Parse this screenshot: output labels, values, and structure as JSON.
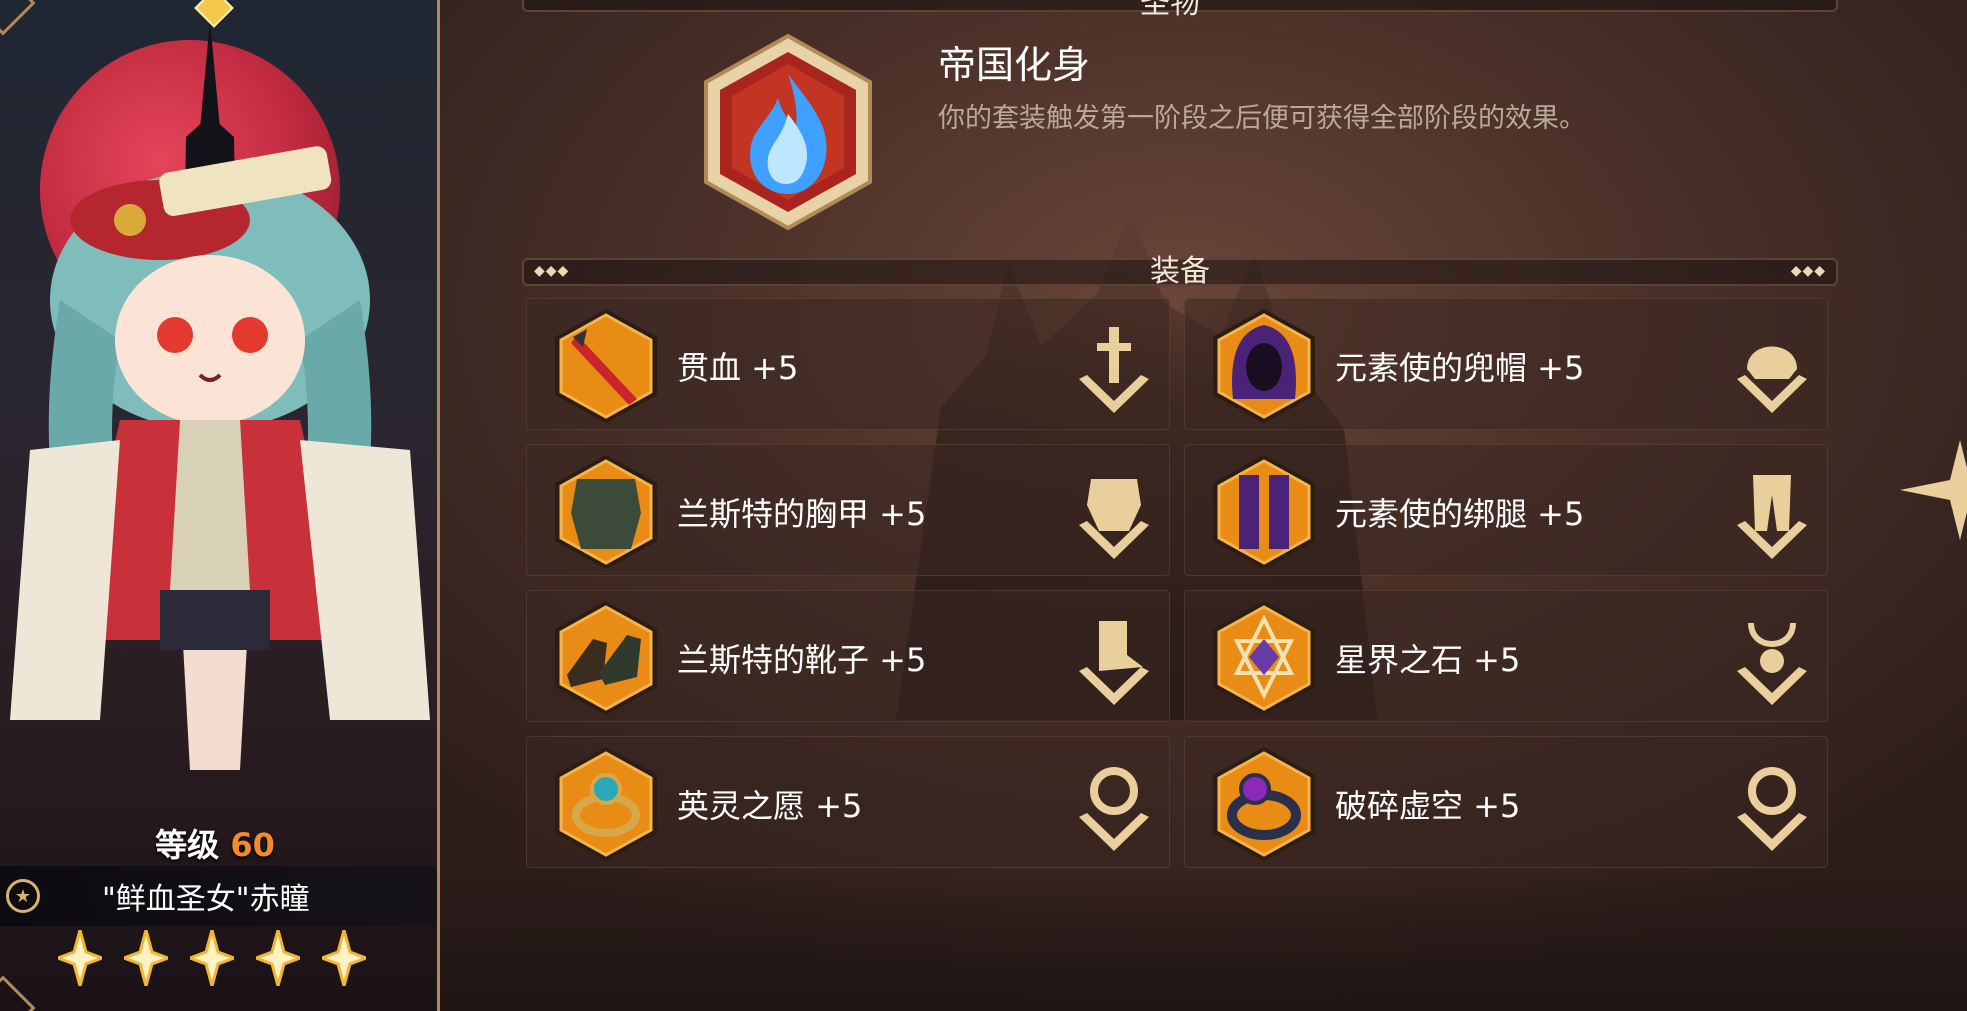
{
  "header": {
    "title": "圣物"
  },
  "artifact": {
    "name": "帝国化身",
    "description": "你的套装触发第一阶段之后便可获得全部阶段的效果。",
    "icon": "blue-flame-icon"
  },
  "section": {
    "title": "装备",
    "dots": "◆◆◆"
  },
  "equipment": [
    {
      "label": "贯血 +5",
      "icon": "sword-icon",
      "type_icon": "weapon-type-icon"
    },
    {
      "label": "元素使的兜帽 +5",
      "icon": "hood-icon",
      "type_icon": "helmet-type-icon"
    },
    {
      "label": "兰斯特的胸甲 +5",
      "icon": "chestplate-icon",
      "type_icon": "armor-type-icon"
    },
    {
      "label": "元素使的绑腿 +5",
      "icon": "leggings-icon",
      "type_icon": "legs-type-icon"
    },
    {
      "label": "兰斯特的靴子 +5",
      "icon": "boots-icon",
      "type_icon": "boots-type-icon"
    },
    {
      "label": "星界之石 +5",
      "icon": "star-gem-icon",
      "type_icon": "amulet-type-icon"
    },
    {
      "label": "英灵之愿 +5",
      "icon": "ring-icon",
      "type_icon": "ring-type-icon"
    },
    {
      "label": "破碎虚空 +5",
      "icon": "dark-ring-icon",
      "type_icon": "ring-type-icon"
    }
  ],
  "character": {
    "level_label": "等级",
    "level": "60",
    "name": "\"鲜血圣女\"赤瞳",
    "stars": 5
  },
  "colors": {
    "gold": "#d9b56c",
    "slot_orange": "#e88c16",
    "level_orange": "#f28b2b"
  }
}
